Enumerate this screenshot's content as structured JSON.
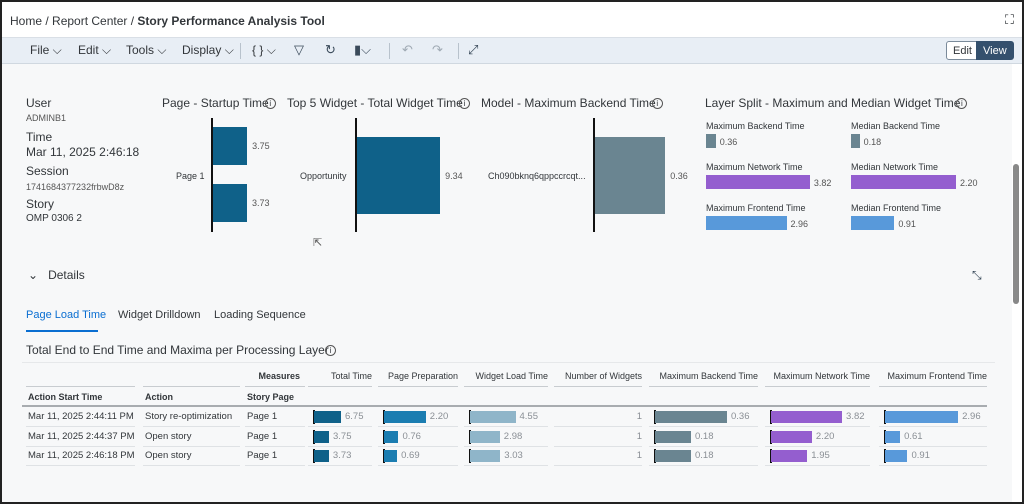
{
  "breadcrumb": {
    "items": [
      "Home /",
      "Report Center /"
    ],
    "current": "Story Performance Analysis Tool"
  },
  "toolbar": {
    "menus": [
      "File",
      "Edit",
      "Tools",
      "Display"
    ],
    "formula": "{ }",
    "edit_label": "Edit",
    "view_label": "View",
    "view_active": true
  },
  "info_panel": [
    {
      "key": "User",
      "value": "ADMINB1"
    },
    {
      "key": "Time",
      "value": "Mar 11, 2025 2:46:18 PM"
    },
    {
      "key": "Session",
      "value": "1741684377232frbwD8z"
    },
    {
      "key": "Story",
      "value": "OMP 0306 2"
    }
  ],
  "charts": {
    "startup": {
      "title": "Page - Startup Time",
      "category": "Page 1",
      "values": [
        3.75,
        3.73
      ]
    },
    "widget": {
      "title": "Top 5 Widget - Total Widget Time",
      "category": "Opportunity",
      "values": [
        9.34
      ]
    },
    "model": {
      "title": "Model - Maximum Backend Time",
      "category": "Ch090bknq6qppccrcqt...",
      "values": [
        0.36
      ]
    },
    "layer": {
      "title": "Layer Split - Maximum and Median Widget Time",
      "items": [
        {
          "label": "Maximum Backend Time",
          "value": 0.36,
          "color": "#6a8591"
        },
        {
          "label": "Median Backend Time",
          "value": 0.18,
          "color": "#6a8591"
        },
        {
          "label": "Maximum Network Time",
          "value": 3.82,
          "color": "#945ecf"
        },
        {
          "label": "Median Network Time",
          "value": 2.2,
          "color": "#945ecf"
        },
        {
          "label": "Maximum Frontend Time",
          "value": 2.96,
          "color": "#5899da"
        },
        {
          "label": "Median Frontend Time",
          "value": 0.91,
          "color": "#5899da"
        }
      ]
    }
  },
  "details": {
    "label": "Details",
    "tabs": [
      "Page Load Time",
      "Widget Drilldown",
      "Loading Sequence"
    ],
    "active_tab": 0
  },
  "table": {
    "title": "Total End to End Time and Maxima per Processing Layer",
    "measures_label": "Measures",
    "dim_headers": [
      "Action Start Time",
      "Action",
      "Story Page"
    ],
    "measure_headers": [
      "Total Time",
      "Page Preparation",
      "Widget Load Time",
      "Number of Widgets",
      "Maximum Backend Time",
      "Maximum Network Time",
      "Maximum Frontend Time"
    ],
    "rows": [
      {
        "dims": [
          "Mar 11, 2025 2:44:11 PM",
          "Story re-optimization",
          "Page 1"
        ],
        "vals": [
          "6.75",
          "2.20",
          "4.55",
          "1",
          "0.36",
          "3.82",
          "2.96"
        ]
      },
      {
        "dims": [
          "Mar 11, 2025 2:44:37 PM",
          "Open story",
          "Page 1"
        ],
        "vals": [
          "3.75",
          "0.76",
          "2.98",
          "1",
          "0.18",
          "2.20",
          "0.61"
        ]
      },
      {
        "dims": [
          "Mar 11, 2025 2:46:18 PM",
          "Open story",
          "Page 1"
        ],
        "vals": [
          "3.73",
          "0.69",
          "3.03",
          "1",
          "0.18",
          "1.95",
          "0.91"
        ]
      }
    ]
  },
  "colors": {
    "total": "#0f6189",
    "prep": "#1b7db1",
    "widget": "#8fb5c9",
    "backend": "#6a8591",
    "network": "#945ecf",
    "frontend": "#5899da",
    "startup": "#0f6189"
  }
}
